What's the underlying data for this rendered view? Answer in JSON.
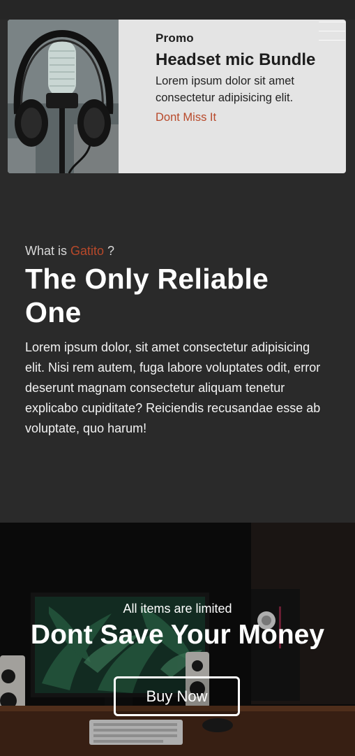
{
  "promo": {
    "label": "Promo",
    "title": "Headset mic Bundle",
    "description": "Lorem ipsum dolor sit amet consectetur adipisicing elit.",
    "link": "Dont Miss It",
    "image_icon": "headphones-microphone-photo"
  },
  "menu": {
    "icon": "hamburger-menu-icon"
  },
  "about": {
    "eyebrow_prefix": "What is ",
    "eyebrow_accent": "Gatito",
    "eyebrow_suffix": " ?",
    "title": "The Only Reliable One",
    "body": "Lorem ipsum dolor, sit amet consectetur adipisicing elit. Nisi rem autem, fuga labore voluptates odit, error deserunt magnam consectetur aliquam tenetur explicabo cupiditate? Reiciendis recusandae esse ab voluptate, quo harum!"
  },
  "hero": {
    "kicker": "All items are limited",
    "title": "Dont Save Your Money",
    "button": "Buy Now",
    "image_icon": "gaming-desk-setup-photo"
  },
  "colors": {
    "accent": "#b8492a",
    "background": "#2a2a2a",
    "card": "#e4e4e4"
  }
}
